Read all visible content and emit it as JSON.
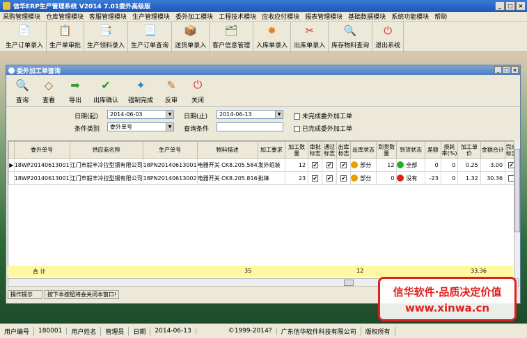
{
  "app": {
    "title": "信华ERP生产管理系统  V2014  7.01委外高级版"
  },
  "menu": [
    "采购管理模块",
    "仓库管理模块",
    "客服管理模块",
    "生产管理模块",
    "委外加工模块",
    "工程技术模块",
    "应收应付模块",
    "报表管理模块",
    "基础数据模块",
    "系统功能模块",
    "帮助"
  ],
  "main_toolbar": [
    {
      "label": "生产订单录入",
      "icon": "pdf-doc-icon",
      "color": "#cc2020"
    },
    {
      "label": "生产单审批",
      "icon": "approve-doc-icon",
      "color": "#408040"
    },
    {
      "label": "生产领料录入",
      "icon": "material-doc-icon",
      "color": "#506090"
    },
    {
      "label": "生产订单查询",
      "icon": "query-doc-icon",
      "color": "#a04060"
    },
    {
      "label": "送货单录入",
      "icon": "delivery-doc-icon",
      "color": "#906030"
    },
    {
      "label": "客户信息管理",
      "icon": "customer-icon",
      "color": "#608060"
    },
    {
      "label": "入库单录入",
      "icon": "stock-in-icon",
      "color": "#e08020"
    },
    {
      "label": "出库单录入",
      "icon": "stock-out-icon",
      "color": "#c03030"
    },
    {
      "label": "库存物料查询",
      "icon": "inventory-icon",
      "color": "#2070c0"
    },
    {
      "label": "退出系统",
      "icon": "exit-icon",
      "color": "#e03030"
    }
  ],
  "child": {
    "title": "委外加工单查询",
    "toolbar": [
      {
        "label": "查询",
        "icon": "magnifier-icon"
      },
      {
        "label": "查看",
        "icon": "view-icon"
      },
      {
        "label": "导出",
        "icon": "export-arrow-icon"
      },
      {
        "label": "出库确认",
        "icon": "checkmark-icon"
      },
      {
        "label": "强制完成",
        "icon": "force-complete-icon"
      },
      {
        "label": "反审",
        "icon": "unapprove-icon"
      },
      {
        "label": "关闭",
        "icon": "close-power-icon"
      }
    ],
    "filters": {
      "date_from_label": "日期(起)",
      "date_from": "2014-06-03",
      "date_to_label": "日期(止)",
      "date_to": "2014-06-13",
      "cond_type_label": "条件类别",
      "cond_type": "委外单号",
      "cond_value_label": "查询条件",
      "cond_value": "",
      "incomplete_label": "未完成委外加工单",
      "complete_label": "已完成委外加工单"
    },
    "columns": [
      "委外单号",
      "供应商名称",
      "生产单号",
      "物料描述",
      "加工要求",
      "加工数量",
      "审批标志",
      "通过标志",
      "出库标志",
      "出库状态",
      "到货数量",
      "到货状态",
      "差额",
      "损耗率(%)",
      "加工单价",
      "金额合计",
      "完成标志"
    ],
    "rows": [
      {
        "order": "18WP20140613001",
        "supplier": "江门市毅丰冷拉型钢有限公司",
        "prod": "18PN20140613001",
        "material": "电器开关 CK8.205.584",
        "req": "发外组装",
        "qty": "12",
        "approved": true,
        "passed": true,
        "outbound": true,
        "out_status": "部分",
        "out_color": "#e8a000",
        "arrived": "12",
        "arr_status": "全部",
        "arr_color": "#20b020",
        "diff": "0",
        "loss": "0",
        "price": "0.25",
        "amount": "3.00",
        "done": true
      },
      {
        "order": "18WP20140613001",
        "supplier": "江门市毅丰冷拉型钢有限公司",
        "prod": "18PN20140613002",
        "material": "电器开关 CK8.205.816",
        "req": "批锋",
        "qty": "23",
        "approved": true,
        "passed": true,
        "outbound": true,
        "out_status": "部分",
        "out_color": "#e8a000",
        "arrived": "0",
        "arr_status": "没有",
        "arr_color": "#e02020",
        "diff": "-23",
        "loss": "0",
        "price": "1.32",
        "amount": "30.36",
        "done": false
      }
    ],
    "summary": {
      "label": "合 计",
      "qty": "35",
      "arrived": "12",
      "amount": "33.36"
    },
    "tips_label": "操作提示",
    "tips_text": "按下本按钮将会关闭本窗口!"
  },
  "banner": {
    "line1": "信华软件·品质决定价值",
    "line2": "www.xinwa.cn"
  },
  "status": {
    "user_id_label": "用户编号",
    "user_id": "180001",
    "user_name_label": "用户姓名",
    "user_name": "管理员",
    "date_label": "日期",
    "date": "2014-06-13",
    "copyright": "©1999-2014?",
    "company": "广东信华软件科技有限公司",
    "rights": "版权所有"
  }
}
